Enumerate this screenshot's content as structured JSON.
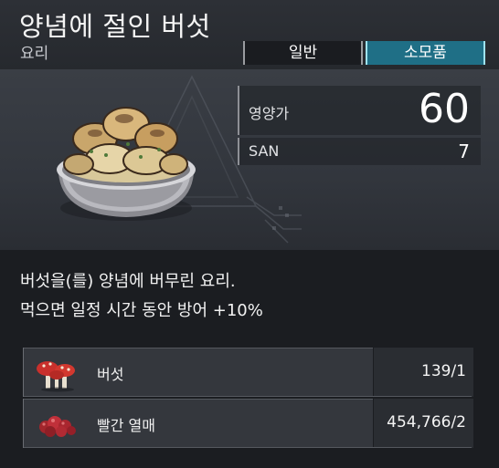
{
  "item": {
    "title": "양념에 절인 버섯",
    "category": "요리"
  },
  "tabs": [
    {
      "label": "일반",
      "active": false
    },
    {
      "label": "소모품",
      "active": true
    }
  ],
  "stats": {
    "nutrition_label": "영양가",
    "nutrition_value": "60",
    "san_label": "SAN",
    "san_value": "7"
  },
  "description": {
    "line1": "버섯을(를) 양념에 버무린 요리.",
    "line2": "먹으면 일정 시간 동안 방어 +10%"
  },
  "ingredients": [
    {
      "name": "버섯",
      "count": "139/1",
      "icon": "mushroom-icon"
    },
    {
      "name": "빨간 열매",
      "count": "454,766/2",
      "icon": "red-berries-icon"
    }
  ],
  "colors": {
    "active_tab": "#1f6f86",
    "active_tab_border": "#9fe3f2",
    "panel_bg": "#1b1d21",
    "item_bg": "#3a3e45"
  }
}
